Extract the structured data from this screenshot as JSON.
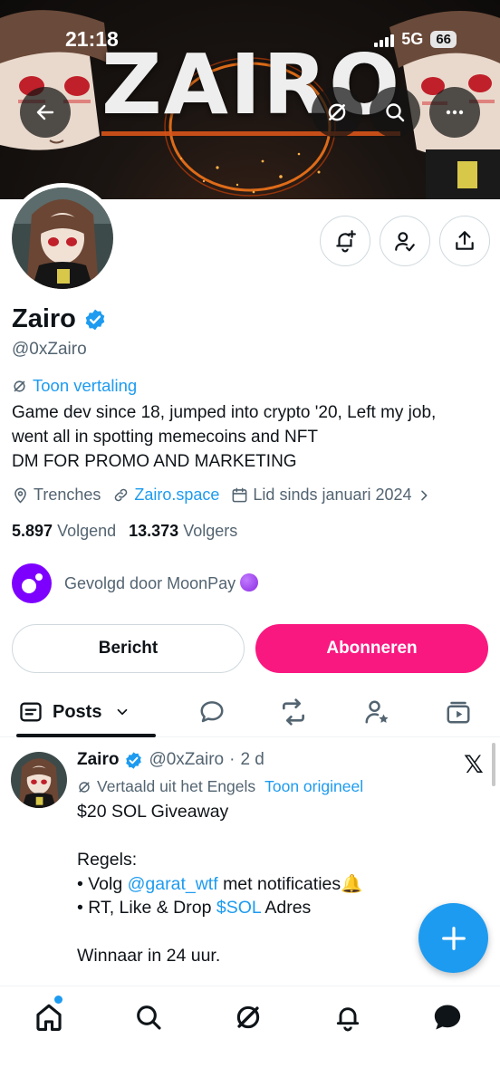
{
  "status_bar": {
    "time": "21:18",
    "network": "5G",
    "battery": "66"
  },
  "banner": {
    "title": "ZAIRO"
  },
  "profile": {
    "name": "Zairo",
    "handle": "@0xZairo",
    "translate_label": "Toon vertaling",
    "bio_lines": [
      "Game dev since 18, jumped into crypto '20, Left my job,",
      "went all in spotting memecoins and NFT",
      "DM FOR PROMO AND MARKETING"
    ],
    "location": "Trenches",
    "website": "Zairo.space",
    "joined": "Lid sinds januari 2024",
    "following_count": "5.897",
    "following_label": "Volgend",
    "followers_count": "13.373",
    "followers_label": "Volgers",
    "followed_by": "Gevolgd door MoonPay",
    "message_button": "Bericht",
    "subscribe_button": "Abonneren"
  },
  "tabs": {
    "active_label": "Posts"
  },
  "post": {
    "name": "Zairo",
    "handle": "@0xZairo",
    "separator": "·",
    "age": "2 d",
    "translated_label": "Vertaald uit het Engels",
    "show_original": "Toon origineel",
    "line1": "$20 SOL Giveaway",
    "rules_heading": "Regels:",
    "rule1_prefix": "• Volg",
    "rule1_mention": "@garat_wtf",
    "rule1_suffix": "met notificaties🔔",
    "rule2_prefix": "• RT, Like & Drop",
    "rule2_cashtag": "$SOL",
    "rule2_suffix": "Adres",
    "closing": "Winnaar in 24 uur."
  },
  "colors": {
    "accent_blue": "#1d9bf0",
    "subscribe_pink": "#f91880",
    "moonpay_purple": "#7d00ff",
    "text_primary": "#0f1419",
    "text_secondary": "#536471"
  }
}
